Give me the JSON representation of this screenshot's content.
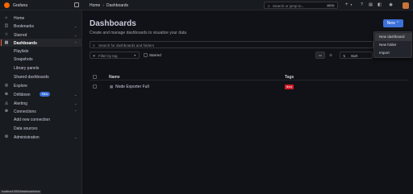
{
  "topbar": {
    "brand": "Grafana",
    "breadcrumb": {
      "home": "Home",
      "separator": "›",
      "current": "Dashboards"
    },
    "search_placeholder": "Search or jump to...",
    "search_shortcut": "ctrl+k",
    "plus_label": "+"
  },
  "sidebar": {
    "items": [
      {
        "label": "Home",
        "icon": "home-icon",
        "glyph": "⌂"
      },
      {
        "label": "Bookmarks",
        "icon": "bookmark-icon",
        "glyph": "◫"
      },
      {
        "label": "Starred",
        "icon": "star-icon",
        "glyph": "☆"
      },
      {
        "label": "Dashboards",
        "icon": "dashboards-icon",
        "glyph": "▦",
        "active": true
      },
      {
        "label": "Explore",
        "icon": "compass-icon",
        "glyph": "◎"
      },
      {
        "label": "Drilldown",
        "icon": "drilldown-icon",
        "glyph": "⊕",
        "badge": "New"
      },
      {
        "label": "Alerting",
        "icon": "bell-icon",
        "glyph": "◬"
      },
      {
        "label": "Connections",
        "icon": "connections-icon",
        "glyph": "⊗"
      },
      {
        "label": "Administration",
        "icon": "gear-icon",
        "glyph": "⚙"
      }
    ],
    "dashboards_sub": [
      "Playlists",
      "Snapshots",
      "Library panels",
      "Shared dashboards"
    ],
    "connections_sub": [
      "Add new connection",
      "Data sources"
    ]
  },
  "main": {
    "title": "Dashboards",
    "subtitle": "Create and manage dashboards to visualize your data",
    "new_button": "New",
    "search_placeholder": "Search for dashboards and folders",
    "tag_filter_placeholder": "Filter by tag",
    "starred_label": "Starred",
    "sort_label": "Sort",
    "table": {
      "columns": [
        "Name",
        "Tags"
      ],
      "rows": [
        {
          "name": "Node Exporter Full",
          "tag": "linux"
        }
      ]
    }
  },
  "new_menu": {
    "items": [
      "New dashboard",
      "New folder",
      "Import"
    ]
  },
  "status_url": "localhost:3000/dashboard/new",
  "colors": {
    "accent_primary": "#3d71d9",
    "active_indicator": "#f55f3e",
    "tag_red": "#d21c2a",
    "logo_orange": "#f46800"
  }
}
